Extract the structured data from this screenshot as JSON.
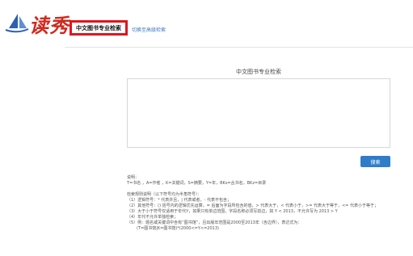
{
  "header": {
    "logo_text": "读秀",
    "active_tab_label": "中文图书专业检索",
    "advanced_link": "切换至高级检索"
  },
  "main": {
    "title": "中文图书专业检索",
    "query": {
      "value": "",
      "placeholder": ""
    },
    "search_button": "搜索"
  },
  "help": {
    "notes_title": "说明：",
    "fields_line": "T=书名 ，A=作者 ，K=关键词，S=摘要，Y=年，BKs=丛书名，BKz=目录",
    "rules_title": "检索规则说明（以下符号均为半角符号）：",
    "rules": [
      "（1）逻辑符号：* 代表并且，| 代表或者，- 代表不包含；",
      "（2）其他符号：() 括号内的逻辑优先运算，= 后面为字段所包含的值，> 代表大于，< 代表小于，>= 代表大于等于，<= 代表小于等于；",
      "（3）大于小于符号仅适用于年代Y，如果只有单边范围，字段名称必须写前边，如 Y < 2013，不允许写为 2013 > Y",
      "（4）年代不允许单独检索；",
      "（5）例：题名或关键词中含有“图书馆”，且出版年范围是2000至2013年（含边界），表达式为："
    ],
    "example": "(T=图书馆|K=图书馆)*(2000<=Y<=2013)"
  },
  "colors": {
    "brand_red": "#cf2a1e",
    "tab_border": "#e1141e",
    "link_blue": "#3a78c3",
    "button_blue": "#2f7dc9"
  }
}
